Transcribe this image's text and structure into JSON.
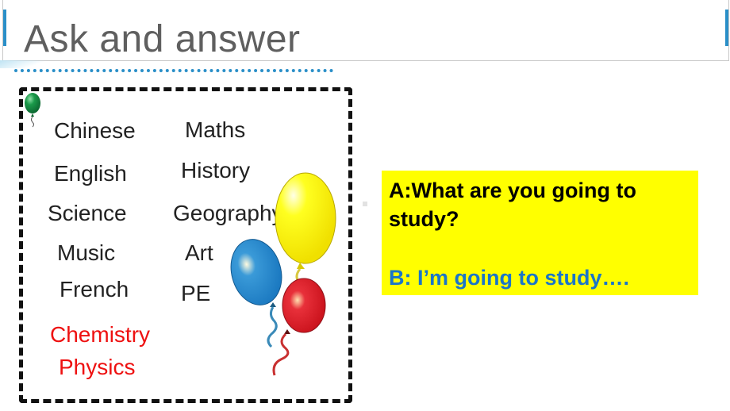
{
  "slide": {
    "title": "Ask and answer",
    "accent_color": "#2a8fc8"
  },
  "subjects": {
    "known": [
      {
        "label": "Chinese"
      },
      {
        "label": "Maths"
      },
      {
        "label": "English"
      },
      {
        "label": "History"
      },
      {
        "label": "Science"
      },
      {
        "label": "Geography"
      },
      {
        "label": "Music"
      },
      {
        "label": "Art"
      },
      {
        "label": "French"
      },
      {
        "label": "PE"
      }
    ],
    "new": [
      {
        "label": "Chemistry"
      },
      {
        "label": "Physics"
      }
    ],
    "new_color": "#ee1111"
  },
  "dialog": {
    "question": "A:What are you going to study?",
    "answer": "B: I’m going to study….",
    "background": "#ffff00",
    "answer_color": "#1a75c9"
  },
  "illustration": {
    "small_balloon": "green-balloon-icon",
    "balloon_cluster": [
      "yellow",
      "blue",
      "red"
    ]
  }
}
